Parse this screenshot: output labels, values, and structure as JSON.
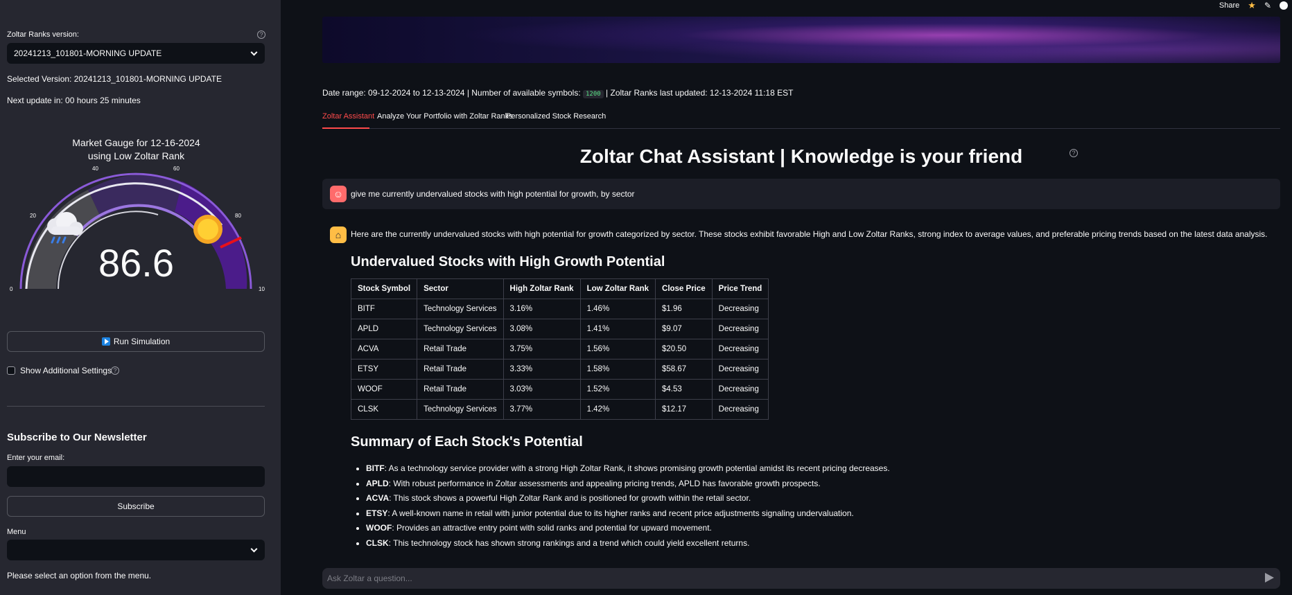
{
  "sidebar": {
    "version_label": "Zoltar Ranks version:",
    "version_value": "20241213_101801-MORNING UPDATE",
    "selected_version": "Selected Version: 20241213_101801-MORNING UPDATE",
    "next_update": "Next update in: 00 hours 25 minutes",
    "gauge": {
      "title_line1": "Market Gauge for 12-16-2024",
      "title_line2": "using Low Zoltar Rank",
      "value": "86.6",
      "needle_value": 86.6,
      "tick_labels": [
        "0",
        "20",
        "40",
        "60",
        "80",
        "10"
      ],
      "zone_colors": [
        "#4a4a4f",
        "#3a2a5e",
        "#4b1c8a"
      ],
      "weather_left_icon": "rain-cloud-icon",
      "weather_right_icon": "sun-icon"
    },
    "run_button": "Run Simulation",
    "show_settings": "Show Additional Settings",
    "newsletter_title": "Subscribe to Our Newsletter",
    "email_label": "Enter your email:",
    "email_value": "",
    "subscribe_button": "Subscribe",
    "menu_label": "Menu",
    "menu_value": "",
    "menu_hint": "Please select an option from the menu."
  },
  "topbar": {
    "share": "Share"
  },
  "info": {
    "date_range": "Date range: 09-12-2024 to 12-13-2024 | Number of available symbols:",
    "symbols": "1200",
    "updated": "| Zoltar Ranks last updated: 12-13-2024 11:18 EST"
  },
  "tabs": [
    "Zoltar Assistant",
    "Analyze Your Portfolio with Zoltar Ranks",
    "Personalized Stock Research"
  ],
  "main_title": "Zoltar Chat Assistant | Knowledge is your friend",
  "user_message": "give me currently undervalued stocks with high potential for growth, by sector",
  "bot_intro": "Here are the currently undervalued stocks with high potential for growth categorized by sector. These stocks exhibit favorable High and Low Zoltar Ranks, strong index to average values, and preferable pricing trends based on the latest data analysis.",
  "table_title": "Undervalued Stocks with High Growth Potential",
  "table": {
    "headers": [
      "Stock Symbol",
      "Sector",
      "High Zoltar Rank",
      "Low Zoltar Rank",
      "Close Price",
      "Price Trend"
    ],
    "rows": [
      [
        "BITF",
        "Technology Services",
        "3.16%",
        "1.46%",
        "$1.96",
        "Decreasing"
      ],
      [
        "APLD",
        "Technology Services",
        "3.08%",
        "1.41%",
        "$9.07",
        "Decreasing"
      ],
      [
        "ACVA",
        "Retail Trade",
        "3.75%",
        "1.56%",
        "$20.50",
        "Decreasing"
      ],
      [
        "ETSY",
        "Retail Trade",
        "3.33%",
        "1.58%",
        "$58.67",
        "Decreasing"
      ],
      [
        "WOOF",
        "Retail Trade",
        "3.03%",
        "1.52%",
        "$4.53",
        "Decreasing"
      ],
      [
        "CLSK",
        "Technology Services",
        "3.77%",
        "1.42%",
        "$12.17",
        "Decreasing"
      ]
    ]
  },
  "summary_title": "Summary of Each Stock's Potential",
  "summary": [
    {
      "sym": "BITF",
      "text": ": As a technology service provider with a strong High Zoltar Rank, it shows promising growth potential amidst its recent pricing decreases."
    },
    {
      "sym": "APLD",
      "text": ": With robust performance in Zoltar assessments and appealing pricing trends, APLD has favorable growth prospects."
    },
    {
      "sym": "ACVA",
      "text": ": This stock shows a powerful High Zoltar Rank and is positioned for growth within the retail sector."
    },
    {
      "sym": "ETSY",
      "text": ": A well-known name in retail with junior potential due to its higher ranks and recent price adjustments signaling undervaluation."
    },
    {
      "sym": "WOOF",
      "text": ": Provides an attractive entry point with solid ranks and potential for upward movement."
    },
    {
      "sym": "CLSK",
      "text": ": This technology stock has shown strong rankings and a trend which could yield excellent returns."
    }
  ],
  "chat_input_placeholder": "Ask Zoltar a question..."
}
